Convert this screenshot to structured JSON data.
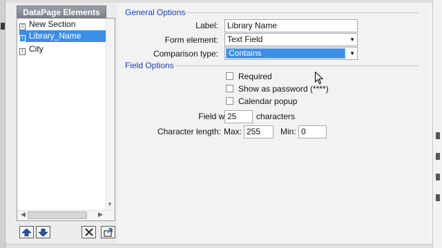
{
  "panel": {
    "title": "DataPage Elements",
    "items": [
      {
        "label": "New Section",
        "icon": "section-icon"
      },
      {
        "label": "Library_Name",
        "icon": "text-field-icon",
        "selected": true
      },
      {
        "label": "City",
        "icon": "text-field-icon"
      }
    ]
  },
  "general": {
    "title": "General Options",
    "label_caption": "Label:",
    "label_value": "Library Name",
    "form_element_caption": "Form element:",
    "form_element_value": "Text Field",
    "comparison_caption": "Comparison type:",
    "comparison_value": "Contains"
  },
  "field_options": {
    "title": "Field Options",
    "required_label": "Required",
    "password_label": "Show as password (****)",
    "calendar_label": "Calendar popup",
    "width_caption": "Field width:",
    "width_value": "25",
    "width_unit": "characters",
    "length_caption": "Character length:",
    "max_caption": "Max:",
    "max_value": "255",
    "min_caption": "Min:",
    "min_value": "0"
  },
  "colors": {
    "accent": "#1a3db8",
    "selection": "#3d8ee6"
  }
}
